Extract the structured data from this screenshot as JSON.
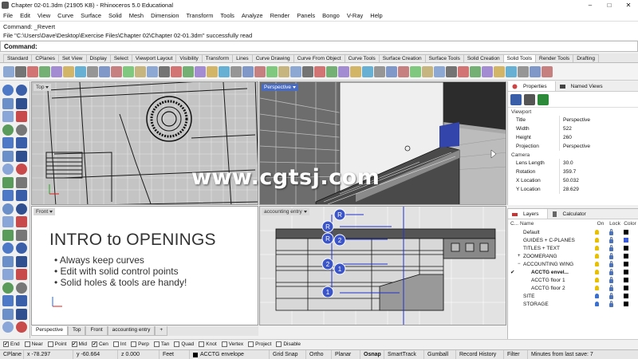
{
  "window": {
    "title": "Chapter 02-01.3dm (21905 KB) - Rhinoceros 5.0 Educational",
    "minimize": "–",
    "maximize": "□",
    "close": "✕"
  },
  "menu": [
    "File",
    "Edit",
    "View",
    "Curve",
    "Surface",
    "Solid",
    "Mesh",
    "Dimension",
    "Transform",
    "Tools",
    "Analyze",
    "Render",
    "Panels",
    "Bongo",
    "V-Ray",
    "Help"
  ],
  "command_history": [
    "Command: _Revert",
    "File \"C:\\Users\\Dave\\Desktop\\Exercise Files\\Chapter 02\\Chapter 02-01.3dm\" successfully read"
  ],
  "command_prompt": {
    "label": "Command:",
    "value": ""
  },
  "toolbar_tabs": [
    "Standard",
    "CPlanes",
    "Set View",
    "Display",
    "Select",
    "Viewport Layout",
    "Visibility",
    "Transform",
    "Lines",
    "Curve Drawing",
    "Curve From Object",
    "Curve Tools",
    "Surface Creation",
    "Surface Tools",
    "Solid Creation",
    "Solid Tools",
    "Render Tools",
    "Drafting"
  ],
  "toolbar_active_tab": "Solid Tools",
  "viewports": {
    "top": "Top",
    "perspective": "Perspective",
    "front": "Front",
    "accounting": "accounting entry"
  },
  "slide": {
    "heading": "INTRO to OPENINGS",
    "bullets": [
      "Always keep curves",
      "Edit with solid control points",
      "Solid holes & tools are handy!"
    ]
  },
  "watermark": "www.cgtsj.com",
  "viewport_tabs": [
    "Perspective",
    "Top",
    "Front",
    "accounting entry"
  ],
  "viewport_tab_add": "+",
  "properties_panel": {
    "tabs": [
      "Properties",
      "Named Views"
    ],
    "sections": [
      {
        "title": "Viewport",
        "rows": [
          {
            "key": "Title",
            "value": "Perspective"
          },
          {
            "key": "Width",
            "value": "522"
          },
          {
            "key": "Height",
            "value": "260"
          },
          {
            "key": "Projection",
            "value": "Perspective"
          }
        ]
      },
      {
        "title": "Camera",
        "rows": [
          {
            "key": "Lens Length",
            "value": "30.0"
          },
          {
            "key": "Rotation",
            "value": "359.7"
          },
          {
            "key": "X Location",
            "value": "50.032"
          },
          {
            "key": "Y Location",
            "value": "28.629"
          }
        ]
      }
    ]
  },
  "layers_panel": {
    "tabs": [
      "Layers",
      "Calculator"
    ],
    "columns": {
      "c": "C...",
      "name": "Name",
      "on": "On",
      "lock": "Lock",
      "color": "Color"
    },
    "rows": [
      {
        "name": "Default",
        "indent": 0,
        "expander": "",
        "bulb": "#e8c000",
        "color": "#000000",
        "current": "",
        "bold": false
      },
      {
        "name": "GUIDES + C-PLANES",
        "indent": 0,
        "expander": "",
        "bulb": "#e8c000",
        "color": "#3b5bd8",
        "current": "",
        "bold": false
      },
      {
        "name": "TITLES + TEXT",
        "indent": 0,
        "expander": "",
        "bulb": "#e8c000",
        "color": "#000000",
        "current": "",
        "bold": false
      },
      {
        "name": "ZOOMERANG",
        "indent": 0,
        "expander": "+",
        "bulb": "#e8c000",
        "color": "#000000",
        "current": "",
        "bold": false
      },
      {
        "name": "ACCOUNTING WING",
        "indent": 0,
        "expander": "−",
        "bulb": "#e8c000",
        "color": "#000000",
        "current": "",
        "bold": false
      },
      {
        "name": "ACCTG envel...",
        "indent": 1,
        "expander": "",
        "bulb": "#e8c000",
        "color": "#000000",
        "current": "✔",
        "bold": true
      },
      {
        "name": "ACCTG floor 1",
        "indent": 1,
        "expander": "",
        "bulb": "#e8c000",
        "color": "#000000",
        "current": "",
        "bold": false
      },
      {
        "name": "ACCTG floor 2",
        "indent": 1,
        "expander": "",
        "bulb": "#e8c000",
        "color": "#000000",
        "current": "",
        "bold": false
      },
      {
        "name": "SITE",
        "indent": 0,
        "expander": "",
        "bulb": "#3b6fd0",
        "color": "#000000",
        "current": "",
        "bold": false
      },
      {
        "name": "STORAGE",
        "indent": 0,
        "expander": "",
        "bulb": "#3b6fd0",
        "color": "#000000",
        "current": "",
        "bold": false
      }
    ]
  },
  "osnaps": [
    {
      "label": "End",
      "checked": true
    },
    {
      "label": "Near",
      "checked": false
    },
    {
      "label": "Point",
      "checked": false
    },
    {
      "label": "Mid",
      "checked": true
    },
    {
      "label": "Cen",
      "checked": true
    },
    {
      "label": "Int",
      "checked": false
    },
    {
      "label": "Perp",
      "checked": false
    },
    {
      "label": "Tan",
      "checked": false
    },
    {
      "label": "Quad",
      "checked": false
    },
    {
      "label": "Knot",
      "checked": false
    },
    {
      "label": "Vertex",
      "checked": false
    },
    {
      "label": "Project",
      "checked": false
    },
    {
      "label": "Disable",
      "checked": false
    }
  ],
  "status": {
    "cplane": "CPlane",
    "x": "x -78.297",
    "y": "y -60.664",
    "z": "z 0.000",
    "units": "Feet",
    "layer": "ACCTG envelope",
    "toggles": [
      "Grid Snap",
      "Ortho",
      "Planar",
      "Osnap",
      "SmartTrack",
      "Gumball",
      "Record History",
      "Filter"
    ],
    "toggle_bold": "Osnap",
    "save_info": "Minutes from last save: 7"
  },
  "annotations": [
    "R",
    "R",
    "R",
    "2",
    "2",
    "1",
    "1"
  ],
  "colors": {
    "accent": "#4a6cc0",
    "grid_lines": "#ffffff",
    "curve_blue": "#2233cc"
  }
}
